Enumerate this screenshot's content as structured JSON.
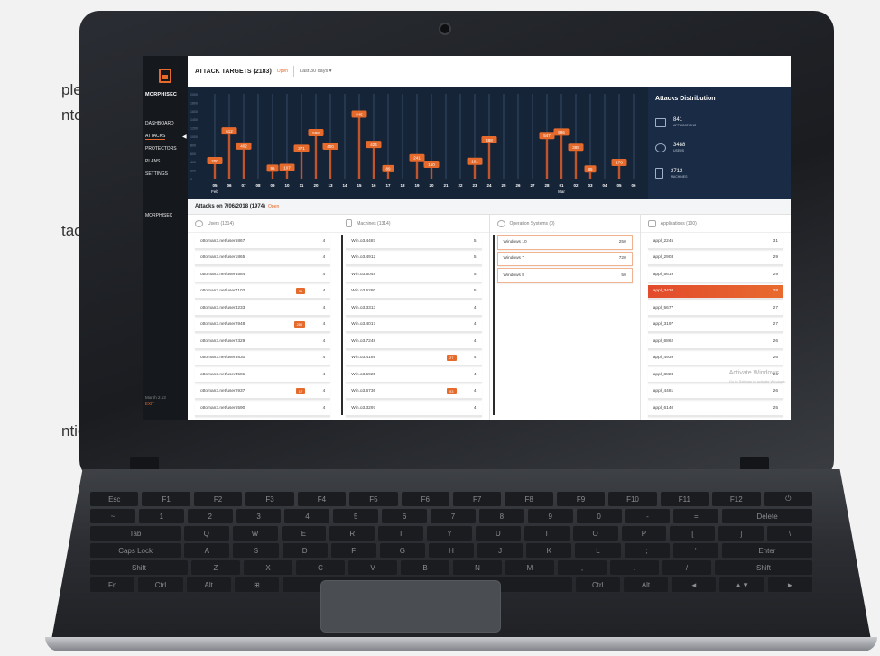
{
  "background_text": [
    "plete",
    "nto",
    "tack",
    "ntion"
  ],
  "sidebar": {
    "brand": "MORPHISEC",
    "items": [
      "DASHBOARD",
      "ATTACKS",
      "PROTECTORS",
      "PLANS",
      "SETTINGS"
    ],
    "active": "ATTACKS",
    "account": "MORPHISEC",
    "footer_version": "Morph 2.13",
    "footer_exit": "EXIT"
  },
  "header": {
    "title": "ATTACK TARGETS (2183)",
    "open_label": "Open",
    "range": "Last 30 days ▾"
  },
  "chart_data": {
    "type": "bar",
    "categories": [
      "05",
      "06",
      "07",
      "08",
      "09",
      "10",
      "11",
      "20",
      "13",
      "14",
      "15",
      "16",
      "17",
      "18",
      "19",
      "20",
      "21",
      "22",
      "23",
      "24",
      "25",
      "26",
      "27",
      "28",
      "01",
      "02",
      "03",
      "04",
      "05",
      "06"
    ],
    "values": [
      200,
      612,
      402,
      0,
      95,
      107,
      371,
      588,
      400,
      0,
      845,
      424,
      89,
      0,
      241,
      150,
      0,
      0,
      191,
      488,
      0,
      0,
      0,
      547,
      596,
      385,
      85,
      0,
      176,
      0
    ],
    "month_labels": [
      {
        "at": "05",
        "label": "Feb"
      },
      {
        "at": "01",
        "label": "Mar"
      }
    ],
    "y_ticks": [
      2000,
      1800,
      1600,
      1400,
      1200,
      1000,
      800,
      600,
      400,
      200,
      0
    ],
    "ylim": [
      0,
      2000
    ]
  },
  "distribution": {
    "title": "Attacks Distribution",
    "items": [
      {
        "num": "841",
        "label": "APPLICATIONS",
        "icon": "window-icon"
      },
      {
        "num": "3488",
        "label": "USERS",
        "icon": "users-icon"
      },
      {
        "num": "2712",
        "label": "MACHINES",
        "icon": "machine-icon"
      }
    ]
  },
  "attacks_on": {
    "title": "Attacks on 7/06/2018 (1974)",
    "open_label": "Open"
  },
  "columns": {
    "users": {
      "title": "Users (1314)",
      "rows": [
        {
          "name": "ottoman3.net\\user5867",
          "badge": "",
          "val": "4"
        },
        {
          "name": "ottoman3.net\\user1865",
          "badge": "",
          "val": "4"
        },
        {
          "name": "ottoman3.net\\user6584",
          "badge": "",
          "val": "4"
        },
        {
          "name": "ottoman3.net\\user7102",
          "badge": "31",
          "val": "4"
        },
        {
          "name": "ottoman3.net\\user4233",
          "badge": "",
          "val": "4"
        },
        {
          "name": "ottoman3.net\\user2948",
          "badge": "280",
          "val": "4"
        },
        {
          "name": "ottoman3.net\\user2329",
          "badge": "",
          "val": "4"
        },
        {
          "name": "ottoman3.net\\user8830",
          "badge": "",
          "val": "4"
        },
        {
          "name": "ottoman3.net\\user3581",
          "badge": "",
          "val": "4"
        },
        {
          "name": "ottoman3.net\\user2937",
          "badge": "17",
          "val": "4"
        },
        {
          "name": "ottoman3.net\\user5590",
          "badge": "",
          "val": "4"
        }
      ]
    },
    "machines": {
      "title": "Machines (1314)",
      "rows": [
        {
          "name": "Win.o3.4487",
          "badge": "",
          "val": "5"
        },
        {
          "name": "Win.o3.4912",
          "badge": "",
          "val": "5"
        },
        {
          "name": "Win.o3.6048",
          "badge": "",
          "val": "5"
        },
        {
          "name": "Win.o3.5280",
          "badge": "",
          "val": "5"
        },
        {
          "name": "Win.o3.3313",
          "badge": "",
          "val": "4"
        },
        {
          "name": "Win.o3.4017",
          "badge": "",
          "val": "4"
        },
        {
          "name": "Win.o3.7248",
          "badge": "",
          "val": "4"
        },
        {
          "name": "Win.o3.4189",
          "badge": "27",
          "val": "4"
        },
        {
          "name": "Win.o3.5925",
          "badge": "",
          "val": "4"
        },
        {
          "name": "Win.o3.6736",
          "badge": "93",
          "val": "4"
        },
        {
          "name": "Win.o3.3297",
          "badge": "",
          "val": "4"
        }
      ]
    },
    "os": {
      "title": "Operation Systems (0)",
      "rows": [
        {
          "name": "Windows 10",
          "val": "250"
        },
        {
          "name": "Windows 7",
          "val": "720"
        },
        {
          "name": "Windows 8",
          "val": "50"
        }
      ]
    },
    "apps": {
      "title": "Applications (100)",
      "rows": [
        {
          "name": "appl_2245",
          "val": "31"
        },
        {
          "name": "appl_2903",
          "val": "29"
        },
        {
          "name": "appl_5619",
          "val": "29"
        },
        {
          "name": "appl_3420",
          "val": "28",
          "hl": true
        },
        {
          "name": "appl_5677",
          "val": "27"
        },
        {
          "name": "appl_3197",
          "val": "27"
        },
        {
          "name": "appl_6862",
          "val": "26"
        },
        {
          "name": "appl_4939",
          "val": "26"
        },
        {
          "name": "appl_8823",
          "val": "26"
        },
        {
          "name": "appl_4481",
          "val": "26"
        },
        {
          "name": "appl_6140",
          "val": "25"
        }
      ]
    },
    "watermark": "Activate Windows",
    "watermark_sub": "Go to Settings to activate Windows."
  },
  "keyboard": {
    "rows": [
      [
        "Esc",
        "F1",
        "F2",
        "F3",
        "F4",
        "F5",
        "F6",
        "F7",
        "F8",
        "F9",
        "F10",
        "F11",
        "F12",
        "⏻"
      ],
      [
        "~",
        "1",
        "2",
        "3",
        "4",
        "5",
        "6",
        "7",
        "8",
        "9",
        "0",
        "-",
        "=",
        "Delete"
      ],
      [
        "Tab",
        "Q",
        "W",
        "E",
        "R",
        "T",
        "Y",
        "U",
        "I",
        "O",
        "P",
        "[",
        "]",
        "\\"
      ],
      [
        "Caps Lock",
        "A",
        "S",
        "D",
        "F",
        "G",
        "H",
        "J",
        "K",
        "L",
        ";",
        "'",
        "Enter"
      ],
      [
        "Shift",
        "Z",
        "X",
        "C",
        "V",
        "B",
        "N",
        "M",
        ",",
        ".",
        "/",
        "Shift"
      ],
      [
        "Fn",
        "Ctrl",
        "Alt",
        "⊞",
        "",
        "Ctrl",
        "Alt",
        "◄",
        "▲▼",
        "►"
      ]
    ]
  }
}
